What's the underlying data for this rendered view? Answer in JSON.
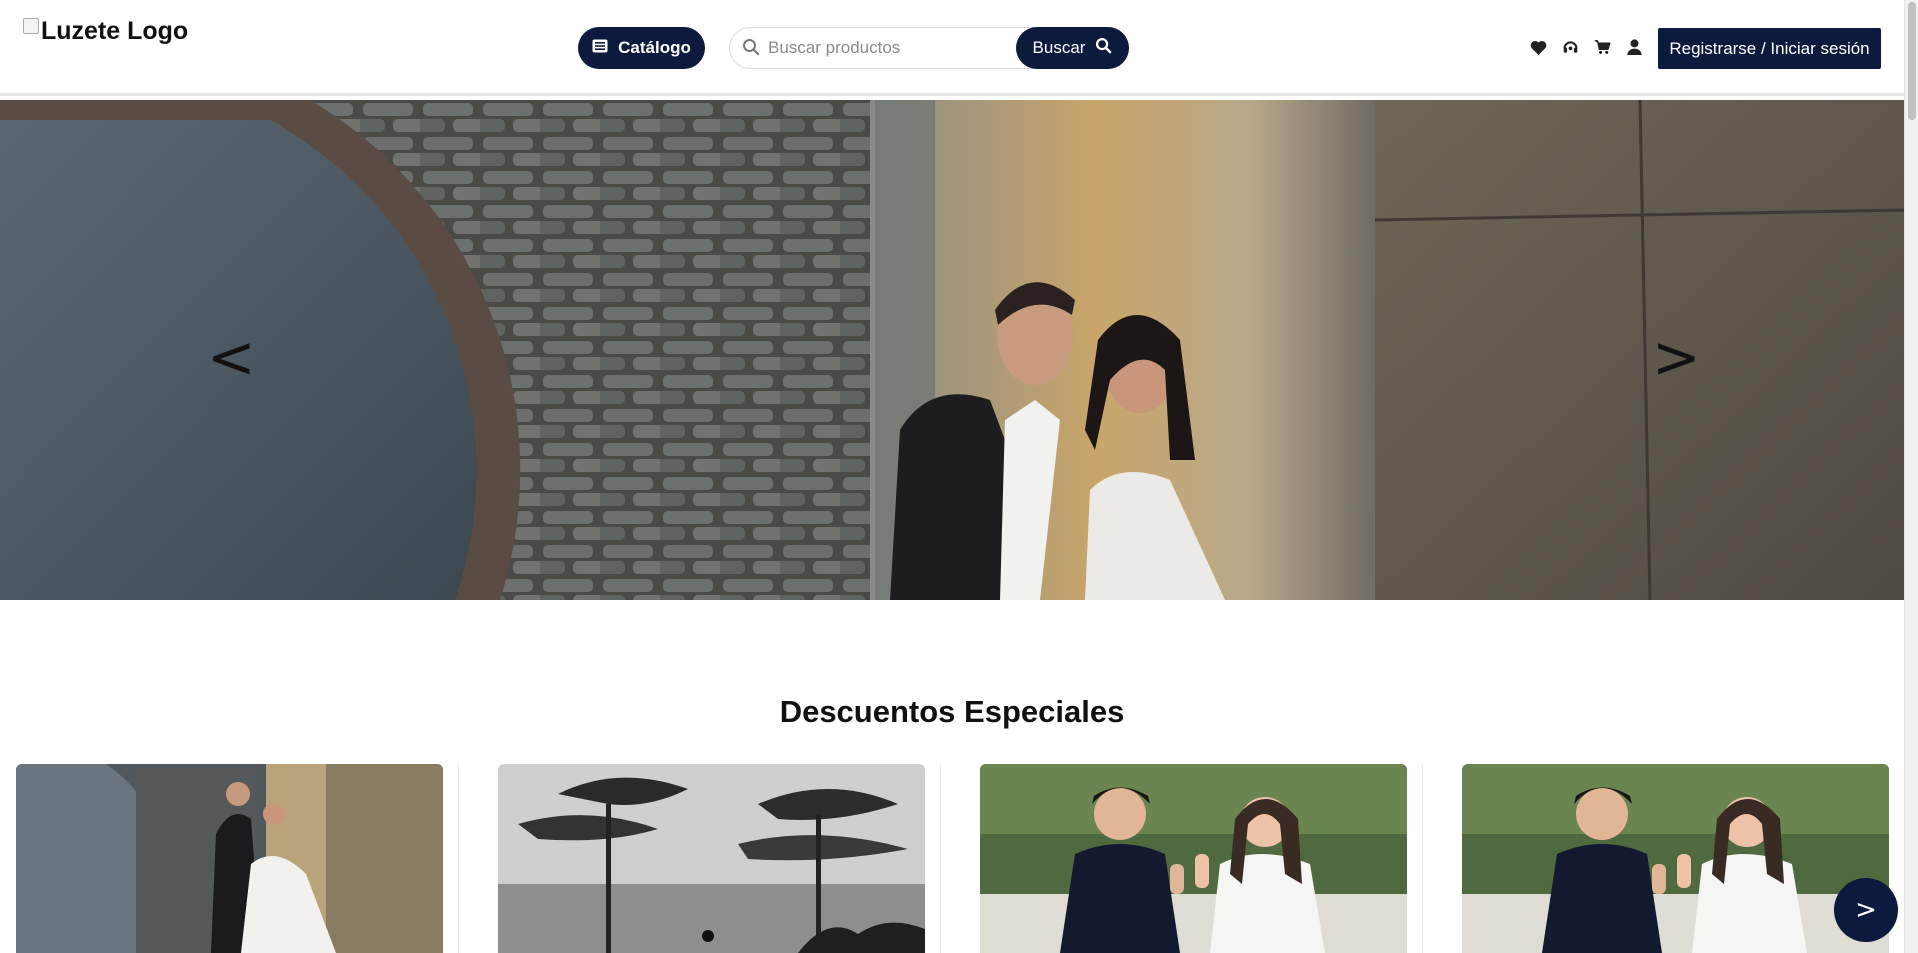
{
  "header": {
    "logo_alt": "Luzete Logo",
    "catalog_label": "Catálogo",
    "search_placeholder": "Buscar productos",
    "search_label": "Buscar",
    "icons": [
      "heart-icon",
      "support-icon",
      "cart-icon",
      "user-icon"
    ],
    "auth_label": "Registrarse / Iniciar sesión"
  },
  "hero": {
    "prev_label": "<",
    "next_label": ">"
  },
  "section": {
    "title": "Descuentos Especiales"
  },
  "float_next_label": ">",
  "colors": {
    "primary": "#0b1a3d",
    "border": "#dcdcdc"
  }
}
